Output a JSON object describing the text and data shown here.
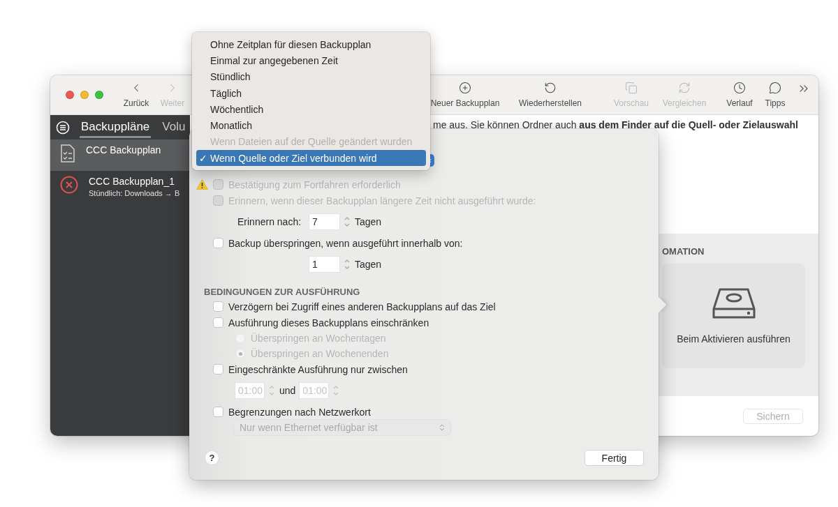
{
  "window": {
    "toolbar": {
      "nav": [
        {
          "label": "Zurück",
          "kind": "back",
          "disabled": false
        },
        {
          "label": "Weiter",
          "kind": "forward",
          "disabled": true
        }
      ],
      "actions": [
        {
          "label": "Neuer Backupplan",
          "kind": "plus",
          "disabled": false
        },
        {
          "label": "Wiederherstellen",
          "kind": "restore",
          "disabled": false
        },
        {
          "label": "Vorschau",
          "kind": "preview",
          "disabled": true
        },
        {
          "label": "Vergleichen",
          "kind": "compare",
          "disabled": true
        },
        {
          "label": "Verlauf",
          "kind": "history",
          "disabled": false
        },
        {
          "label": "Tipps",
          "kind": "tips",
          "disabled": false
        }
      ]
    },
    "sidebar": {
      "tabs": [
        {
          "label": "Backuppläne",
          "selected": true
        },
        {
          "label": "Volu",
          "selected": false
        }
      ],
      "items": [
        {
          "title": "CCC Backupplan",
          "kind": "ok",
          "selected": true
        },
        {
          "title": "CCC Backupplan_1",
          "subtitle": "Stündlich: Downloads → B",
          "kind": "error",
          "selected": false
        }
      ]
    },
    "intro": "me aus. Sie können Ordner auch **aus dem Finder auf die Quell- oder Zielauswahl**",
    "automation": {
      "heading": "OMATION",
      "card_label": "Beim Aktivieren ausführen"
    },
    "save_button": {
      "label": "Sichern",
      "disabled": true
    }
  },
  "popover": {
    "rows": [
      {
        "kind": "checkbox",
        "label": "Bestätigung zum Fortfahren erforderlich",
        "checked": false,
        "disabled": true,
        "warning": true
      },
      {
        "kind": "checkbox",
        "label": "Erinnern, wenn dieser Backupplan längere Zeit nicht ausgeführt wurde:",
        "checked": false,
        "disabled": true,
        "warning": false
      },
      {
        "kind": "stepper",
        "label": "Erinnern nach:",
        "value": "7",
        "unit": "Tagen"
      },
      {
        "kind": "checkbox",
        "label": "Backup überspringen, wenn ausgeführt innerhalb von:",
        "checked": false,
        "disabled": false,
        "warning": false
      },
      {
        "kind": "stepper",
        "value": "1",
        "unit": "Tagen"
      },
      {
        "kind": "heading",
        "label": "BEDINGUNGEN ZUR AUSFÜHRUNG"
      },
      {
        "kind": "checkbox",
        "label": "Verzögern bei Zugriff eines anderen Backupplans auf das Ziel",
        "checked": false,
        "disabled": false,
        "warning": false
      },
      {
        "kind": "checkbox",
        "label": "Ausführung dieses Backupplans einschränken",
        "checked": false,
        "disabled": false,
        "warning": false
      },
      {
        "kind": "radio",
        "label": "Überspringen an Wochentagen",
        "selected": false,
        "disabled": true
      },
      {
        "kind": "radio",
        "label": "Überspringen an Wochenenden",
        "selected": true,
        "disabled": true
      },
      {
        "kind": "checkbox",
        "label": "Eingeschränkte Ausführung nur zwischen",
        "checked": false,
        "disabled": false,
        "warning": false
      },
      {
        "kind": "time_range",
        "from": "01:00",
        "joiner": "und",
        "to": "01:00",
        "disabled": true
      },
      {
        "kind": "checkbox",
        "label": "Begrenzungen nach Netzwerkort",
        "checked": false,
        "disabled": false,
        "warning": false
      },
      {
        "kind": "select",
        "value": "Nur wenn Ethernet verfügbar ist",
        "disabled": true
      }
    ],
    "help": "?",
    "done_button": "Fertig"
  },
  "menu": {
    "checkmark": "✓",
    "items": [
      {
        "label": "Ohne Zeitplan für diesen Backupplan",
        "selected": false,
        "disabled": false
      },
      {
        "label": "Einmal zur angegebenen Zeit",
        "selected": false,
        "disabled": false
      },
      {
        "label": "Stündlich",
        "selected": false,
        "disabled": false
      },
      {
        "label": "Täglich",
        "selected": false,
        "disabled": false
      },
      {
        "label": "Wöchentlich",
        "selected": false,
        "disabled": false
      },
      {
        "label": "Monatlich",
        "selected": false,
        "disabled": false
      },
      {
        "label": "Wenn Dateien auf der Quelle geändert wurden",
        "selected": false,
        "disabled": true
      },
      {
        "label": "Wenn Quelle oder Ziel verbunden wird",
        "selected": true,
        "disabled": false
      }
    ]
  }
}
